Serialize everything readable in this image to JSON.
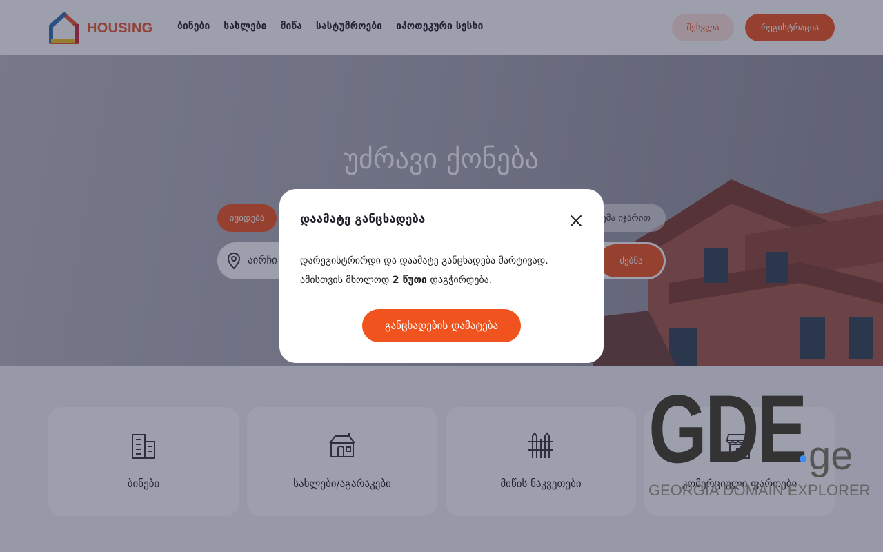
{
  "header": {
    "logo_text": "HOUSING",
    "nav": [
      "ბინები",
      "სახლები",
      "მიწა",
      "სასტუმროები",
      "იპოთეკური სესხი"
    ],
    "login_label": "შესვლა",
    "register_label": "რეგისტრაცია"
  },
  "hero": {
    "title": "უძრავი ქონება",
    "deal_active": "იყიდება",
    "deal_other": "ემა იჯარით",
    "search_text": "აირჩი",
    "search_button": "ძებნა"
  },
  "categories": [
    {
      "label": "ბინები",
      "icon": "apartment-building-icon"
    },
    {
      "label": "სახლები/აგარაკები",
      "icon": "house-icon"
    },
    {
      "label": "მიწის ნაკვეთები",
      "icon": "fence-icon"
    },
    {
      "label": "კომერციული ფართები",
      "icon": "storefront-icon"
    }
  ],
  "modal": {
    "title": "დაამატე განცხადება",
    "body_line1": "დარეგისტრირდი და დაამატე განცხადება მარტივად.",
    "body_line2_pre": "ამისთვის მხოლოდ ",
    "body_line2_bold": "2 წუთი",
    "body_line2_post": " დაგჭირდება.",
    "button_label": "განცხადების დამატება"
  },
  "watermark": {
    "main": "GDE",
    "suffix": "ge",
    "subtitle": "GEORGIA DOMAIN EXPLORER"
  },
  "colors": {
    "accent": "#f0531d",
    "accent_light": "#fde3da",
    "text_dark": "#1f1f2b"
  }
}
